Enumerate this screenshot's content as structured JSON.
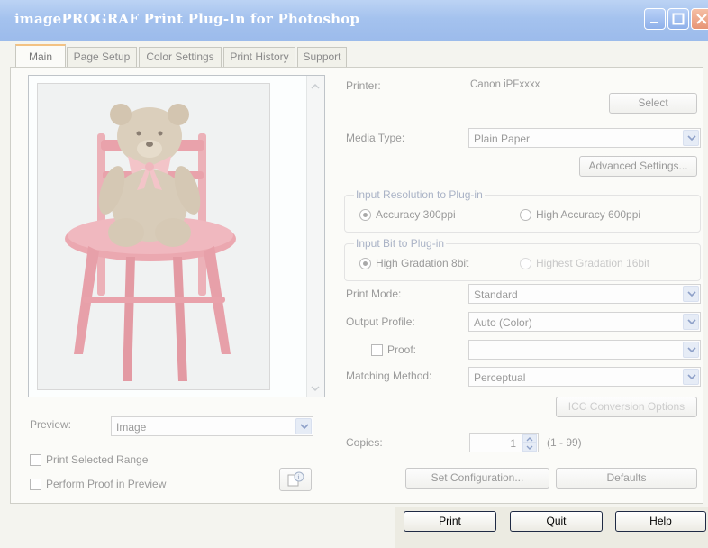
{
  "window": {
    "title": "imagePROGRAF Print Plug-In for Photoshop",
    "controls": [
      "minimize-icon",
      "maximize-icon",
      "close-icon"
    ]
  },
  "tabs": [
    {
      "label": "Main",
      "active": true
    },
    {
      "label": "Page Setup"
    },
    {
      "label": "Color Settings"
    },
    {
      "label": "Print History"
    },
    {
      "label": "Support"
    }
  ],
  "preview_panel": {
    "preview_label": "Preview:",
    "preview_value": "Image",
    "print_selected_range": {
      "label": "Print Selected Range",
      "checked": false
    },
    "perform_proof": {
      "label": "Perform Proof in Preview",
      "checked": false
    },
    "info_icon": "info-icon"
  },
  "printer": {
    "label": "Printer:",
    "value": "Canon iPFxxxx",
    "select_button": "Select"
  },
  "media_type": {
    "label": "Media Type:",
    "value": "Plain Paper",
    "advanced_button": "Advanced Settings..."
  },
  "input_resolution": {
    "title": "Input Resolution to Plug-in",
    "option1": {
      "label": "Accuracy 300ppi",
      "selected": true
    },
    "option2": {
      "label": "High Accuracy 600ppi",
      "selected": false
    }
  },
  "input_bit": {
    "title": "Input Bit to Plug-in",
    "option1": {
      "label": "High Gradation 8bit",
      "selected": true
    },
    "option2": {
      "label": "Highest Gradation 16bit",
      "selected": false
    }
  },
  "print_mode": {
    "label": "Print Mode:",
    "value": "Standard"
  },
  "output_profile": {
    "label": "Output Profile:",
    "value": "Auto (Color)"
  },
  "proof": {
    "label": "Proof:",
    "value": "",
    "checked": false
  },
  "matching_method": {
    "label": "Matching Method:",
    "value": "Perceptual"
  },
  "icc_button": "ICC Conversion Options",
  "copies": {
    "label": "Copies:",
    "value": "1",
    "range": "(1 - 99)"
  },
  "set_configuration_button": "Set Configuration...",
  "defaults_button": "Defaults",
  "footer": {
    "print": "Print",
    "quit": "Quit",
    "help": "Help"
  },
  "colors": {
    "titlebar": "#a4c2ee",
    "active_tab_accent": "#f3c283",
    "chair": "#e8a8b0",
    "bear": "#d4c6b2"
  }
}
